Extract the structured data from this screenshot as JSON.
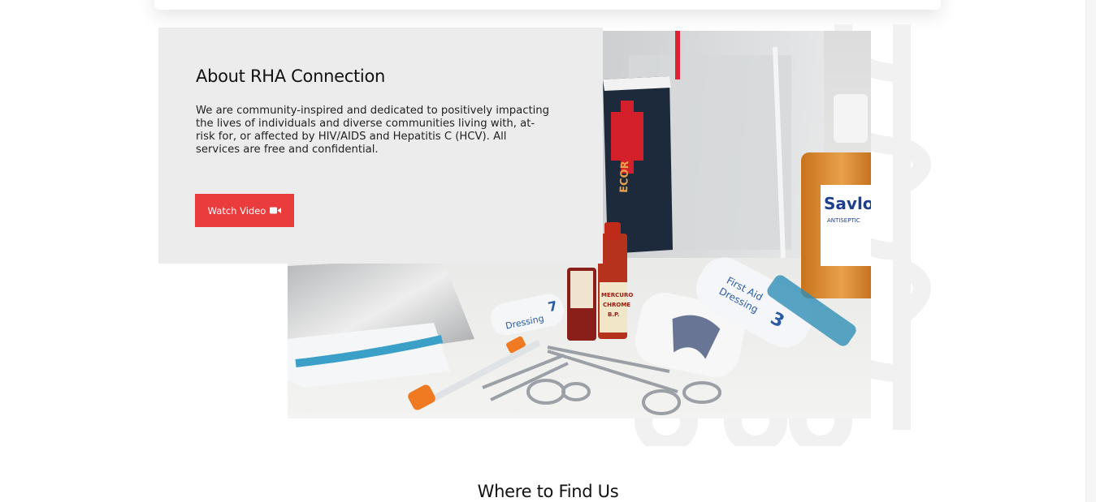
{
  "about": {
    "title": "About RHA Connection",
    "description": "We are community-inspired and dedicated to positively impacting the lives of individuals and diverse communities living with, at-risk for, or affected by HIV/AIDS and Hepatitis C (HCV). All services are free and confidential.",
    "watch_label": "Watch Video",
    "watch_icon": "video-camera-icon"
  },
  "photo": {
    "labels": {
      "savlon": "Savlon",
      "antiseptic": "ANTISEPTIC",
      "mercuro": "MERCURO",
      "chrome": "CHROME",
      "bp": "B.P.",
      "first_aid": "First Aid",
      "dressing": "Dressing",
      "dressing_num": "3",
      "dressing_left": "Dressing",
      "dressing_left_num": "7",
      "ecor": "ECOR"
    }
  },
  "find": {
    "title": "Where to Find Us"
  },
  "colors": {
    "accent": "#ea3b3d",
    "card_bg": "#ececed",
    "text": "#111111"
  }
}
